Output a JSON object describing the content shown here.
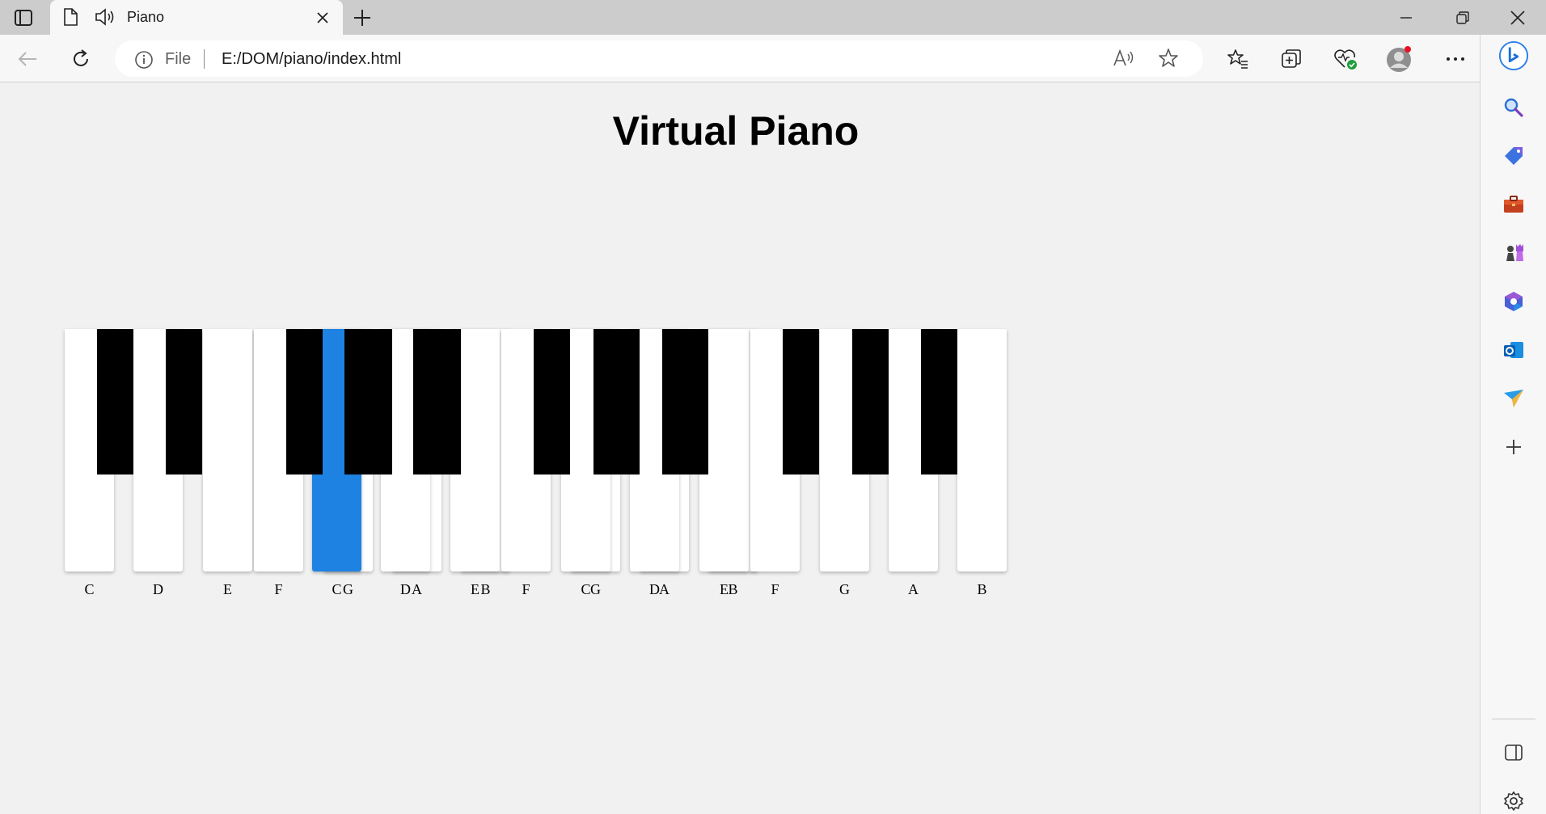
{
  "browser": {
    "tab_title": "Piano",
    "address_scheme": "File",
    "address_url": "E:/DOM/piano/index.html"
  },
  "page": {
    "title": "Virtual Piano"
  },
  "piano": {
    "white_keys": [
      "C",
      "D",
      "E",
      "F",
      "G",
      "A",
      "B",
      "C",
      "D",
      "E",
      "F",
      "G",
      "A",
      "B",
      "C",
      "D",
      "E",
      "F",
      "G",
      "A",
      "B"
    ],
    "active_key_index": 7,
    "active_color": "#1e82e3"
  }
}
